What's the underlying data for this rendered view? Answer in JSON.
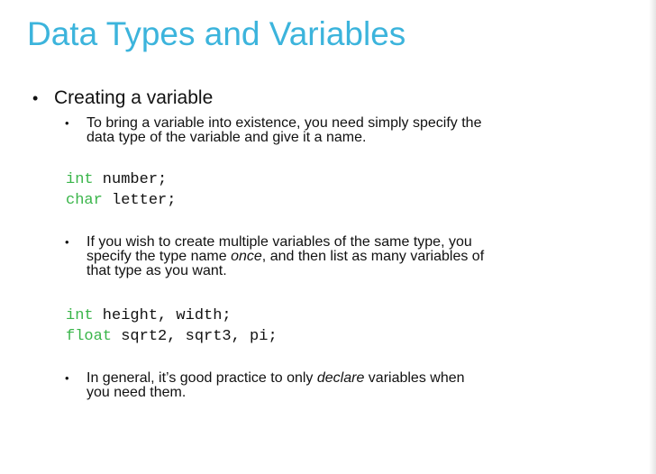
{
  "slide": {
    "title": "Data Types and Variables",
    "bullet": {
      "marker": "•",
      "text": "Creating a variable"
    },
    "sub_marker": "•",
    "point1": {
      "line1": "To bring a variable into existence, you need simply specify the",
      "line2": "data type of the variable and give it a name."
    },
    "code1": [
      {
        "keyword": "int",
        "rest": " number;"
      },
      {
        "keyword": "char",
        "rest": " letter;"
      }
    ],
    "point2": {
      "line1": "If you wish to create multiple variables of the same type, you",
      "line2_before": "specify the type name ",
      "line2_emph": "once",
      "line2_after": ", and then list as many variables of",
      "line3": "that type as you want."
    },
    "code2": [
      {
        "keyword": "int",
        "rest": " height, width;"
      },
      {
        "keyword": "float",
        "rest": " sqrt2, sqrt3, pi;"
      }
    ],
    "point3": {
      "line1_before": "In general, it’s good practice to only ",
      "line1_emph": "declare",
      "line1_after": " variables when",
      "line2": "you need them."
    }
  },
  "colors": {
    "title": "#3cb4dc",
    "keyword": "#3ab54a",
    "text": "#111111",
    "background": "#ffffff"
  }
}
